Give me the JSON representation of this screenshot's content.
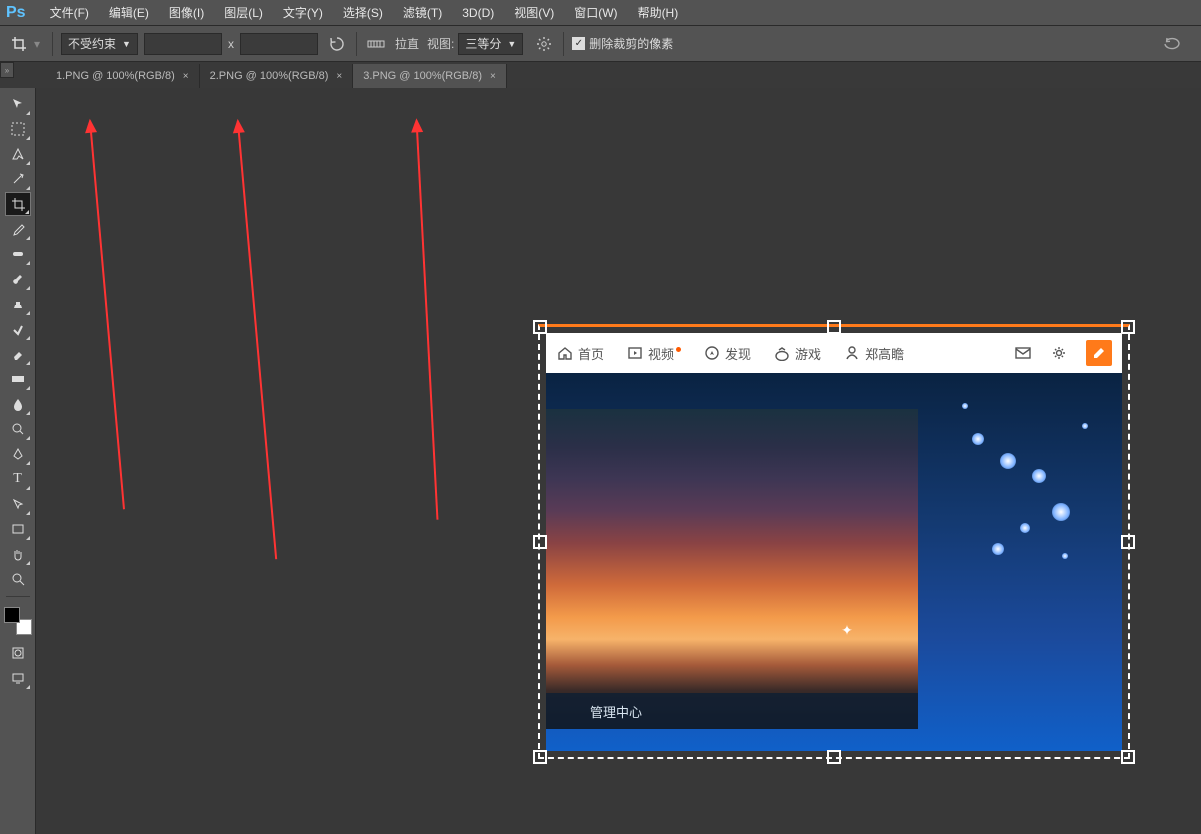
{
  "menu": {
    "items": [
      "文件(F)",
      "编辑(E)",
      "图像(I)",
      "图层(L)",
      "文字(Y)",
      "选择(S)",
      "滤镜(T)",
      "3D(D)",
      "视图(V)",
      "窗口(W)",
      "帮助(H)"
    ]
  },
  "options": {
    "constraint": "不受约束",
    "straighten_label": "拉直",
    "view_label": "视图:",
    "view_value": "三等分",
    "delete_label": "删除裁剪的像素"
  },
  "tabs": [
    {
      "label": "1.PNG @ 100%(RGB/8)",
      "active": false
    },
    {
      "label": "2.PNG @ 100%(RGB/8)",
      "active": false
    },
    {
      "label": "3.PNG @ 100%(RGB/8)",
      "active": true
    }
  ],
  "web": {
    "nav": {
      "home": "首页",
      "video": "视频",
      "discover": "发现",
      "game": "游戏",
      "user": "郑高瞻"
    },
    "caption": "管理中心"
  },
  "colors": {
    "accent": "#ff7a1a"
  }
}
